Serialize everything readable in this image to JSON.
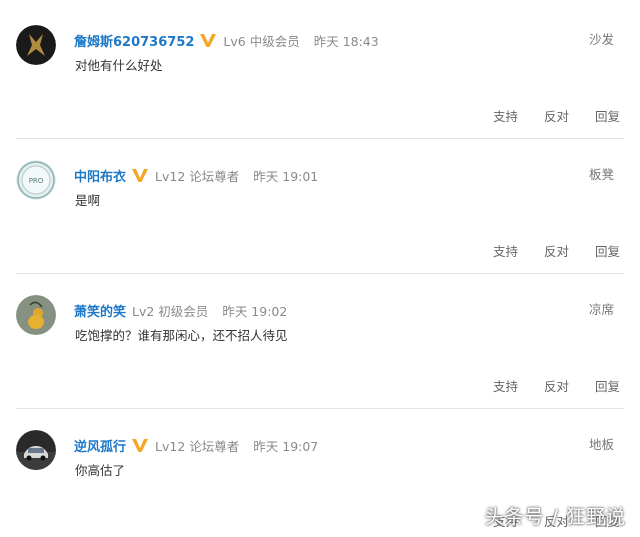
{
  "comments": [
    {
      "username": "詹姆斯620736752",
      "level": "Lv6 中级会员",
      "time": "昨天 18:43",
      "floor": "沙发",
      "text": "对他有什么好处",
      "actions": {
        "support": "支持",
        "oppose": "反对",
        "reply": "回复"
      },
      "avatar_icon": "dark-logo-avatar"
    },
    {
      "username": "中阳布衣",
      "level": "Lv12 论坛尊者",
      "time": "昨天 19:01",
      "floor": "板凳",
      "text": "是啊",
      "actions": {
        "support": "支持",
        "oppose": "反对",
        "reply": "回复"
      },
      "avatar_icon": "teal-circle-avatar",
      "avatar_text": "PRO"
    },
    {
      "username": "萧笑的笑",
      "level": "Lv2 初级会员",
      "time": "昨天 19:02",
      "floor": "凉席",
      "text": "吃饱撑的？谁有那闲心，还不招人待见",
      "actions": {
        "support": "支持",
        "oppose": "反对",
        "reply": "回复"
      },
      "avatar_icon": "gourd-avatar"
    },
    {
      "username": "逆风孤行",
      "level": "Lv12 论坛尊者",
      "time": "昨天 19:07",
      "floor": "地板",
      "text": "你高估了",
      "actions": {
        "support": "支持",
        "oppose": "反对",
        "reply": "回复"
      },
      "avatar_icon": "car-avatar"
    }
  ],
  "watermark": "头条号 / 狂野说",
  "colors": {
    "username": "#1e78c8",
    "badge": "#f5a623",
    "divider": "#e4e4e4"
  }
}
